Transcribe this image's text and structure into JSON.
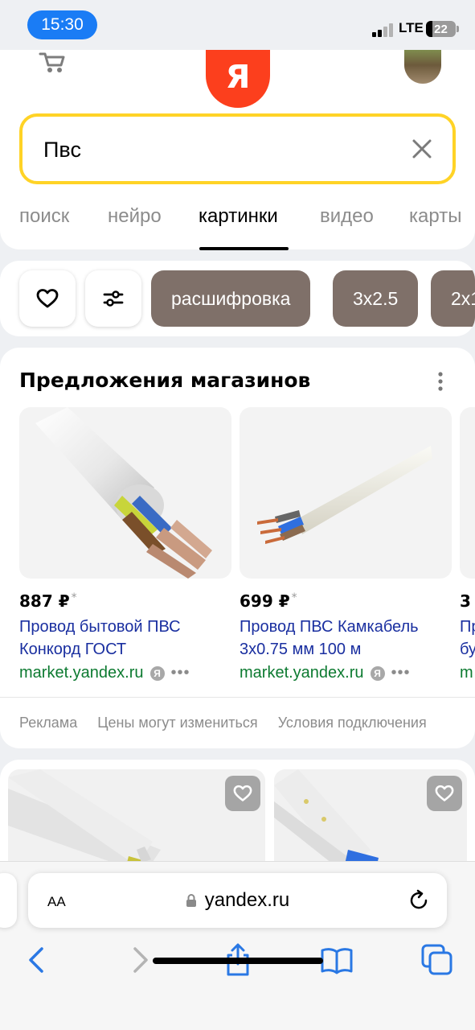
{
  "status_bar": {
    "time": "15:30",
    "network": "LTE",
    "battery": "22",
    "battery_level": 0.22
  },
  "header": {
    "logo_letter": "Я",
    "search_value": "Пвс"
  },
  "tabs": [
    {
      "label": "поиск",
      "active": false
    },
    {
      "label": "нейро",
      "active": false
    },
    {
      "label": "картинки",
      "active": true
    },
    {
      "label": "видео",
      "active": false
    },
    {
      "label": "карты",
      "active": false
    }
  ],
  "chips": [
    "расшифровка",
    "3х2.5",
    "2х1"
  ],
  "offers": {
    "title": "Предложения магазинов",
    "products": [
      {
        "price": "887 ₽",
        "name": "Провод бытовой ПВС Конкорд ГОСТ",
        "shop": "market.yandex.ru"
      },
      {
        "price": "699 ₽",
        "name": "Провод ПВС Камкабель 3х0.75 мм 100 м",
        "shop": "market.yandex.ru"
      },
      {
        "price": "3",
        "name": "Пр бу",
        "shop": "m"
      }
    ],
    "ya_badge": "Я",
    "footer": {
      "ad": "Реклама",
      "prices_note": "Цены могут измениться",
      "terms": "Условия подключения"
    }
  },
  "browser": {
    "text_size": "AA",
    "url": "yandex.ru"
  }
}
